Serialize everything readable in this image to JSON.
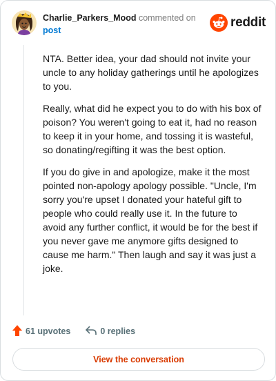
{
  "comment": {
    "username": "Charlie_Parkers_Mood",
    "action_text": "commented on",
    "post_link": "post",
    "paragraphs": [
      "NTA. Better idea, your dad should not invite your uncle to any holiday gatherings until he apologizes to you.",
      "Really, what did he expect you to do with his box of poison? You weren't going to eat it, had no reason to keep it in your home, and tossing it is wasteful, so donating/regifting it was the best option.",
      "If you do give in and apologize, make it the most pointed non-apology apology possible. \"Uncle, I'm sorry you're upset I donated your hateful gift to people who could really use it. In the future to avoid any further conflict, it would be for the best if you never gave me anymore gifts designed to cause me harm.\" Then laugh and say it was just a joke."
    ]
  },
  "brand": {
    "name": "reddit",
    "icon": "reddit-alien-logo",
    "color": "#ff4500"
  },
  "footer": {
    "upvotes": "61 upvotes",
    "upvote_icon": "upvote-arrow-icon",
    "replies": "0 replies",
    "reply_icon": "reply-arrow-icon",
    "cta": "View the conversation"
  },
  "colors": {
    "accent": "#d93a00",
    "link": "#0079d3",
    "upvote": "#ff4500",
    "muted": "#576f76"
  }
}
